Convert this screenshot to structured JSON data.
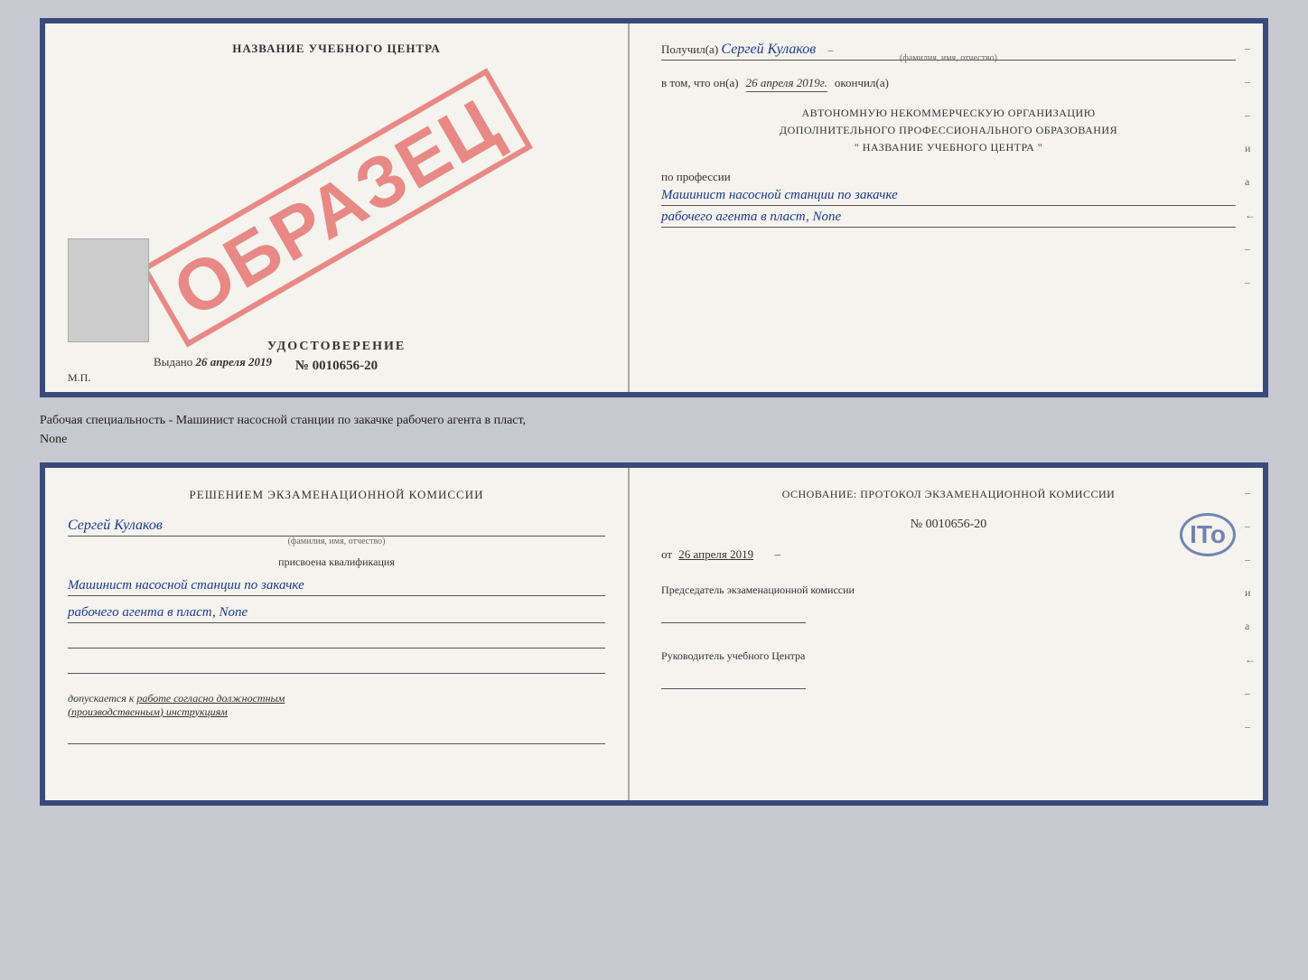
{
  "top_certificate": {
    "left": {
      "training_center": "НАЗВАНИЕ УЧЕБНОГО ЦЕНТРА",
      "sample_stamp": "ОБРАЗЕЦ",
      "doc_title": "УДОСТОВЕРЕНИЕ",
      "doc_number": "№ 0010656-20",
      "issued_prefix": "Выдано",
      "issued_date": "26 апреля 2019",
      "mp_label": "М.П."
    },
    "right": {
      "received_prefix": "Получил(а)",
      "received_name": "Сергей Кулаков",
      "name_hint": "(фамилия, имя, отчество)",
      "date_prefix": "в том, что он(а)",
      "date_value": "26 апреля 2019г.",
      "finished_suffix": "окончил(а)",
      "org_line1": "АВТОНОМНУЮ НЕКОММЕРЧЕСКУЮ ОРГАНИЗАЦИЮ",
      "org_line2": "ДОПОЛНИТЕЛЬНОГО ПРОФЕССИОНАЛЬНОГО ОБРАЗОВАНИЯ",
      "org_line3": "\"  НАЗВАНИЕ УЧЕБНОГО ЦЕНТРА  \"",
      "profession_prefix": "по профессии",
      "profession_line1": "Машинист насосной станции по закачке",
      "profession_line2": "рабочего агента в пласт, None",
      "dashes": [
        "-",
        "-",
        "-",
        "и",
        "а",
        "←",
        "-",
        "-",
        "-",
        "-"
      ]
    }
  },
  "description": {
    "text": "Рабочая специальность - Машинист насосной станции по закачке рабочего агента в пласт,",
    "text2": "None"
  },
  "bottom_certificate": {
    "left": {
      "decision_title": "Решением  экзаменационной  комиссии",
      "person_name": "Сергей Кулаков",
      "name_hint": "(фамилия, имя, отчество)",
      "qualification_assigned": "присвоена квалификация",
      "qualification_line1": "Машинист насосной станции по закачке",
      "qualification_line2": "рабочего агента в пласт, None",
      "admission_text": "допускается к  работе согласно должностным\n(производственным) инструкциям"
    },
    "right": {
      "basis_title": "Основание:  протокол  экзаменационной  комиссии",
      "protocol_number": "№  0010656-20",
      "protocol_date_prefix": "от",
      "protocol_date": "26 апреля 2019",
      "chairman_title": "Председатель экзаменационной\nкомиссии",
      "director_title": "Руководитель учебного\nЦентра",
      "dashes": [
        "-",
        "-",
        "-",
        "и",
        "а",
        "←",
        "-",
        "-",
        "-",
        "-"
      ],
      "ito_stamp": "ITo"
    }
  }
}
